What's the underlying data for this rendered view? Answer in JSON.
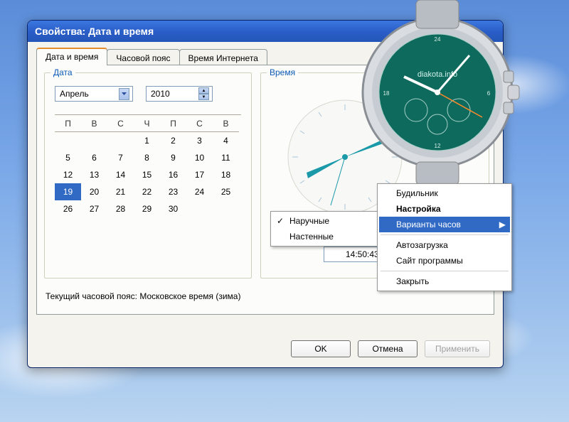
{
  "window": {
    "title": "Свойства: Дата и время"
  },
  "tabs": [
    {
      "label": "Дата и время",
      "active": true
    },
    {
      "label": "Часовой пояс",
      "active": false
    },
    {
      "label": "Время Интернета",
      "active": false
    }
  ],
  "date_group": {
    "legend": "Дата",
    "month": "Апрель",
    "year": "2010",
    "weekdays": [
      "П",
      "В",
      "С",
      "Ч",
      "П",
      "С",
      "В"
    ],
    "grid": [
      [
        "",
        "",
        "",
        "1",
        "2",
        "3",
        "4"
      ],
      [
        "5",
        "6",
        "7",
        "8",
        "9",
        "10",
        "11"
      ],
      [
        "12",
        "13",
        "14",
        "15",
        "16",
        "17",
        "18"
      ],
      [
        "19",
        "20",
        "21",
        "22",
        "23",
        "24",
        "25"
      ],
      [
        "26",
        "27",
        "28",
        "29",
        "30",
        "",
        ""
      ]
    ],
    "selected": "19"
  },
  "time_group": {
    "legend": "Время",
    "value": "14:50:43"
  },
  "timezone_label": "Текущий часовой пояс: Московское время (зима)",
  "buttons": {
    "ok": "OK",
    "cancel": "Отмена",
    "apply": "Применить"
  },
  "watch_brand": "diakota.info",
  "context_menu": {
    "submenu": {
      "items": [
        {
          "label": "Наручные",
          "checked": true
        },
        {
          "label": "Настенные",
          "checked": false
        }
      ]
    },
    "main": {
      "items": [
        {
          "label": "Будильник"
        },
        {
          "label": "Настройка",
          "bold": true
        },
        {
          "label": "Варианты часов",
          "highlighted": true,
          "submenu": true
        },
        {
          "sep": true
        },
        {
          "label": "Автозагрузка"
        },
        {
          "label": "Сайт программы"
        },
        {
          "sep": true
        },
        {
          "label": "Закрыть"
        }
      ]
    }
  }
}
